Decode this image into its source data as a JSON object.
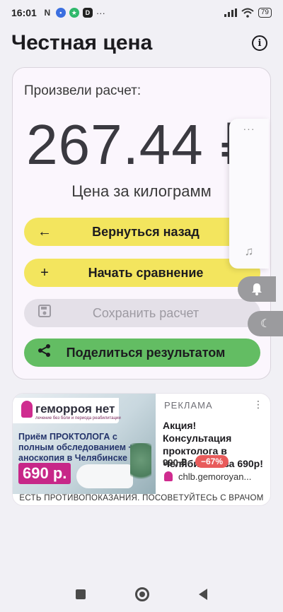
{
  "status_bar": {
    "time": "16:01",
    "battery": "79",
    "notif_icons": [
      "nfc-icon",
      "message-icon",
      "green-app-icon",
      "d-app-icon"
    ],
    "more": "···"
  },
  "header": {
    "title": "Честная цена",
    "info_icon": "i"
  },
  "result": {
    "label": "Произвели расчет:",
    "price": "267.44 ₽",
    "unit_label": "Цена за килограмм"
  },
  "buttons": {
    "back": {
      "label": "Вернуться назад",
      "icon": "arrow-left-icon",
      "glyph": "←"
    },
    "compare": {
      "label": "Начать сравнение",
      "icon": "plus-icon",
      "glyph": "+"
    },
    "save": {
      "label": "Сохранить расчет",
      "icon": "save-icon",
      "glyph": "🖫"
    },
    "share": {
      "label": "Поделиться результатом",
      "icon": "share-icon",
      "glyph": "⋖"
    }
  },
  "ad": {
    "label": "РЕКЛАМА",
    "brand": "геморроя нет",
    "brand_sub": "лечение без боли и периода реабилитации",
    "promo_text": "Приём ПРОКТОЛОГА с полным обследованием + аноскопия в Челябинске",
    "promo_price": "690 р.",
    "headline": "Акция! Консультация проктолога в Челябинске за 690р!",
    "price": "990 ₽",
    "discount": "−67%",
    "domain": "chlb.gemoroyan...",
    "disclaimer": "ЕСТЬ ПРОТИВОПОКАЗАНИЯ. ПОСОВЕТУЙТЕСЬ С ВРАЧОМ",
    "more_icon": "⋮"
  },
  "float_panel": {
    "dots": "···",
    "music_glyph": "♫",
    "bell_glyph": "🔔",
    "moon_glyph": "☾"
  },
  "colors": {
    "accent_yellow": "#f3e55e",
    "share_green": "#63bd63",
    "card_bg": "#fbf6fd",
    "ad_pink": "#cf2c8f"
  }
}
